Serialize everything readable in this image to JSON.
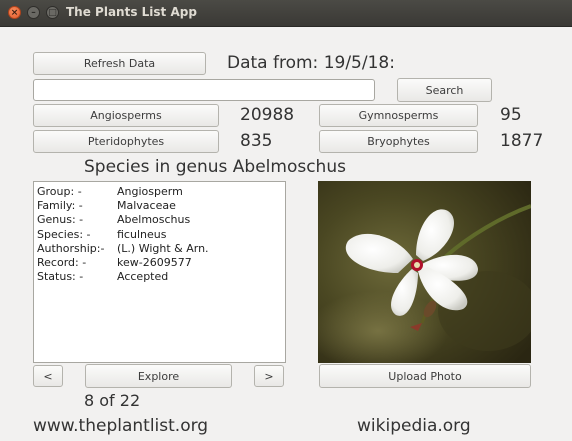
{
  "window": {
    "title": "The Plants List App"
  },
  "toolbar": {
    "refresh_label": "Refresh Data",
    "data_from": "Data from: 19/5/18:",
    "search_value": "",
    "search_label": "Search"
  },
  "groups": {
    "angiosperms_label": "Angiosperms",
    "angiosperms_count": "20988",
    "gymnosperms_label": "Gymnosperms",
    "gymnosperms_count": "95",
    "pteridophytes_label": "Pteridophytes",
    "pteridophytes_count": "835",
    "bryophytes_label": "Bryophytes",
    "bryophytes_count": "1877"
  },
  "genus_heading": "Species in genus Abelmoschus",
  "record": [
    {
      "key": "Group: -",
      "value": "Angiosperm"
    },
    {
      "key": "Family: -",
      "value": "Malvaceae"
    },
    {
      "key": "Genus: -",
      "value": "Abelmoschus"
    },
    {
      "key": "Species: -",
      "value": "ficulneus"
    },
    {
      "key": "Authorship:-",
      "value": "(L.) Wight & Arn."
    },
    {
      "key": "Record: -",
      "value": "kew-2609577"
    },
    {
      "key": "Status: -",
      "value": "Accepted"
    }
  ],
  "nav": {
    "prev_label": "<",
    "explore_label": "Explore",
    "next_label": ">",
    "position": "8 of 22"
  },
  "upload_label": "Upload Photo",
  "links": {
    "plantlist": "www.theplantlist.org",
    "wikipedia": "wikipedia.org"
  },
  "colors": {
    "background": "#f2f1f0",
    "titlebar": "#3c3b37",
    "close": "#e95420"
  },
  "icons": {
    "close": "close-icon",
    "minimize": "minimize-icon",
    "maximize": "maximize-icon"
  }
}
